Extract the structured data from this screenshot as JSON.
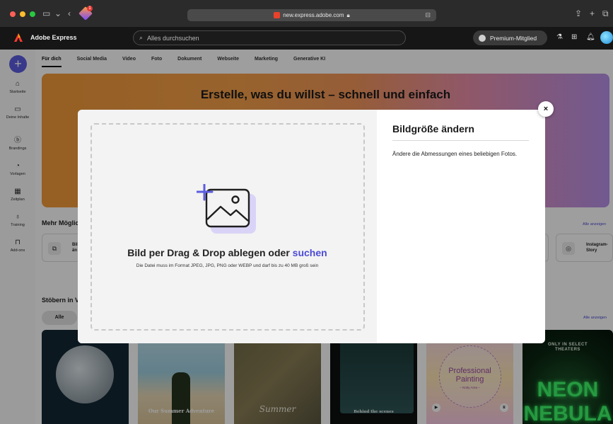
{
  "browser": {
    "url": "new.express.adobe.com",
    "lock_icon": "lock-icon",
    "extension_badge": "1"
  },
  "app": {
    "brand": "Adobe Express",
    "search_placeholder": "Alles durchsuchen",
    "premium_label": "Premium-Mitglied"
  },
  "rail": {
    "items": [
      {
        "label": "Startseite",
        "icon": "home-icon"
      },
      {
        "label": "Deine Inhalte",
        "icon": "folder-icon"
      },
      {
        "label": "Brandings",
        "icon": "brand-icon"
      },
      {
        "label": "Vorlagen",
        "icon": "templates-icon"
      },
      {
        "label": "Zeitplan",
        "icon": "calendar-icon"
      },
      {
        "label": "Training",
        "icon": "lightbulb-icon"
      },
      {
        "label": "Add-ons",
        "icon": "addons-icon"
      }
    ]
  },
  "tabs": [
    "Für dich",
    "Social Media",
    "Video",
    "Foto",
    "Dokument",
    "Webseite",
    "Marketing",
    "Generative KI"
  ],
  "banner": {
    "title": "Erstelle, was du willst – schnell und einfach"
  },
  "sections": {
    "mehr_title": "Mehr Möglic",
    "alle_anzeigen_1": "Alle anzeigen",
    "card_left_text": "Bil\nän",
    "card_right_text": "Instagram-\nStory",
    "stobern_title": "Stöbern in V",
    "alle_anzeigen_2": "Alle anzeigen",
    "filter_all": "Alle"
  },
  "thumbs": {
    "t2_caption": "Our Summer Adventure",
    "t3_caption": "Summer",
    "t4_caption": "Behind the scenes",
    "t5_caption_1": "Professional",
    "t5_caption_2": "Painting",
    "t5_sub": "– Notty Area –",
    "t6_top": "ONLY IN SELECT\nTHEATERS",
    "t6_title": "NEON\nNEBULA"
  },
  "modal": {
    "drop_title_main": "Bild per Drag & Drop ablegen oder ",
    "drop_title_link": "suchen",
    "drop_subtitle": "Die Datei muss im Format JPEG, JPG, PNG oder WEBP und darf bis zu 40 MB groß sein",
    "panel_title": "Bildgröße ändern",
    "panel_description": "Ändere die Abmessungen eines beliebigen Fotos.",
    "close_symbol": "×"
  },
  "colors": {
    "accent": "#5c5ce0",
    "link": "#4b4bd6"
  }
}
